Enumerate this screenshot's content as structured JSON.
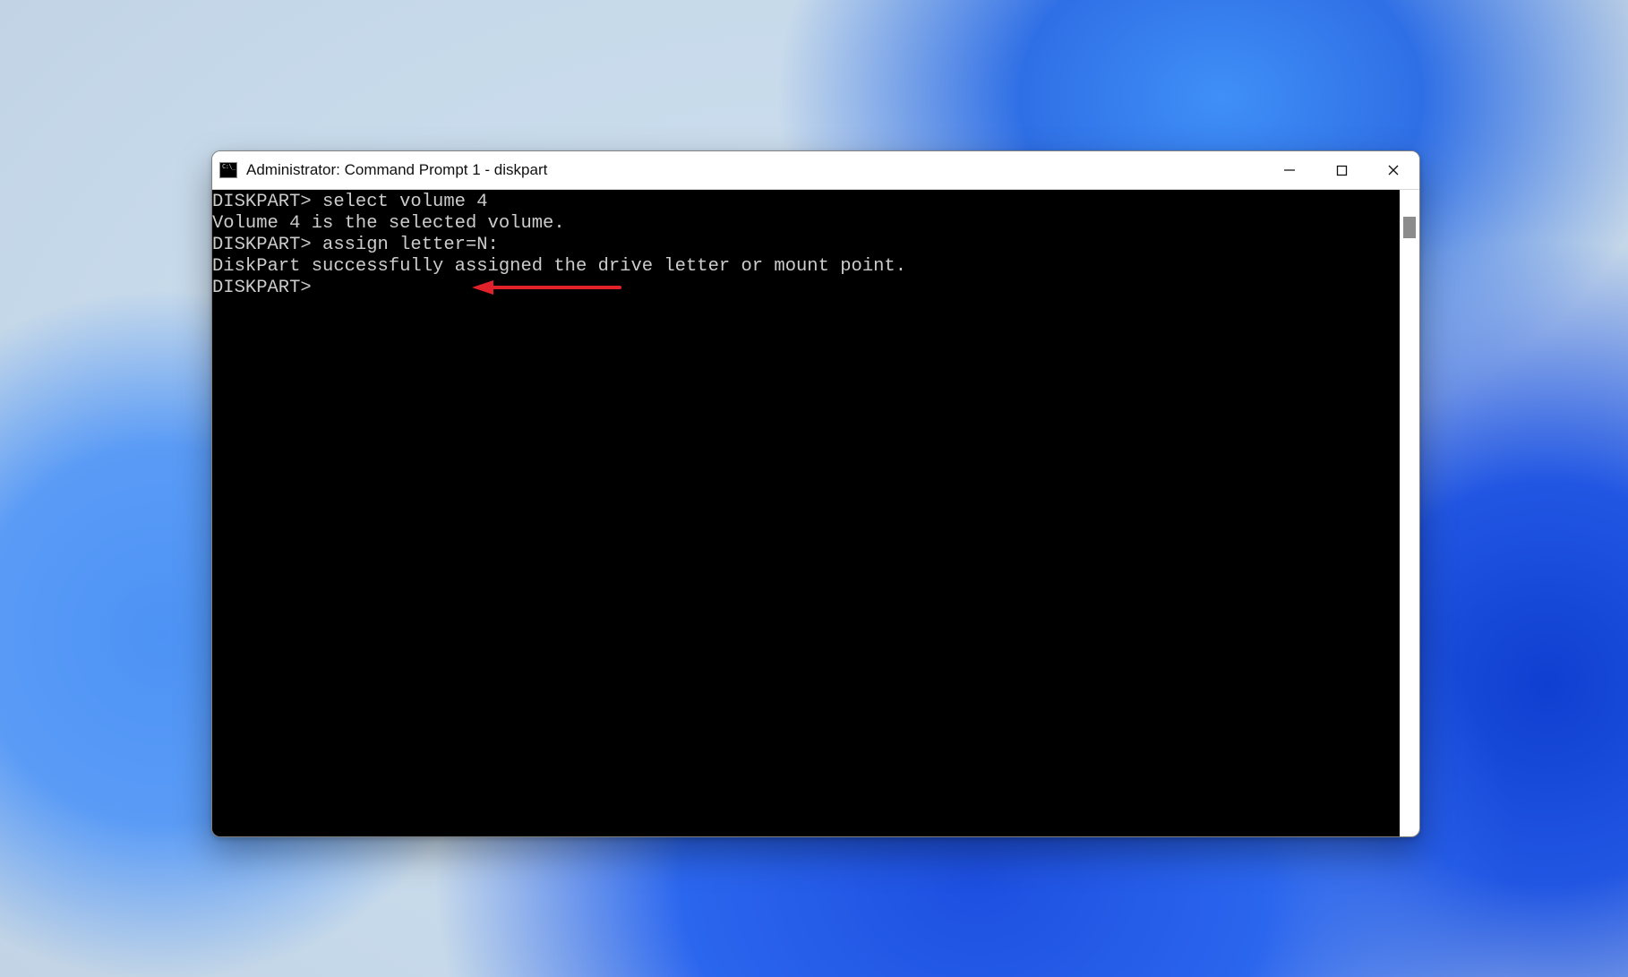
{
  "window": {
    "title": "Administrator: Command Prompt 1 - diskpart"
  },
  "terminal": {
    "lines": [
      {
        "prompt": "DISKPART> ",
        "cmd": "select volume 4"
      },
      {
        "text": ""
      },
      {
        "text": "Volume 4 is the selected volume."
      },
      {
        "text": ""
      },
      {
        "prompt": "DISKPART> ",
        "cmd": "assign letter=N:",
        "annotated": true
      },
      {
        "text": ""
      },
      {
        "text": "DiskPart successfully assigned the drive letter or mount point."
      },
      {
        "text": ""
      },
      {
        "prompt": "DISKPART> ",
        "cmd": ""
      }
    ]
  },
  "annotation": {
    "color": "#e2202a"
  }
}
